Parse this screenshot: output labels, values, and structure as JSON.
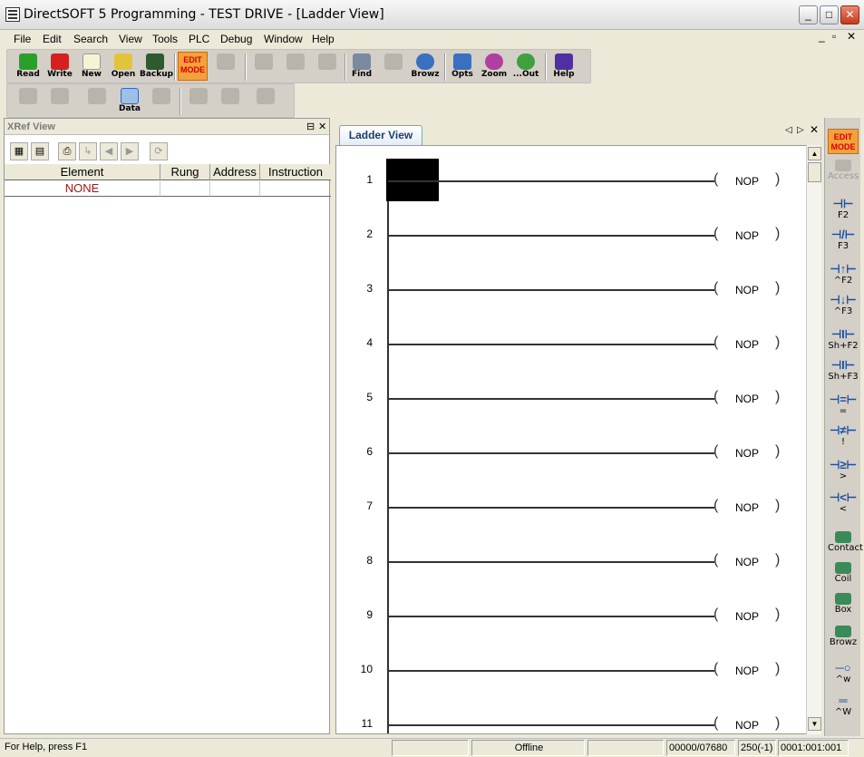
{
  "window": {
    "title": "DirectSOFT 5 Programming - TEST DRIVE - [Ladder View]",
    "minimize": "_",
    "maximize": "□",
    "close": "✕"
  },
  "menu": [
    "File",
    "Edit",
    "Search",
    "View",
    "Tools",
    "PLC",
    "Debug",
    "Window",
    "Help"
  ],
  "mdi_controls": {
    "minimize": "_",
    "restore": "▫",
    "close": "✕"
  },
  "toolbar1": [
    {
      "label": "Read",
      "icon": "read-icon",
      "color": "#2aa02a"
    },
    {
      "label": "Write",
      "icon": "write-icon",
      "color": "#d42020"
    },
    {
      "label": "New",
      "icon": "new-icon",
      "color": "#f5f5d6"
    },
    {
      "label": "Open",
      "icon": "open-icon",
      "color": "#e2c43a"
    },
    {
      "label": "Backup",
      "icon": "backup-icon",
      "color": "#2f5a2f"
    },
    {
      "label": "Find",
      "icon": "find-icon",
      "color": "#7a8aa0"
    },
    {
      "label": "Browz",
      "icon": "browse-icon",
      "color": "#3a70c0"
    },
    {
      "label": "Opts",
      "icon": "options-icon",
      "color": "#3a70c0"
    },
    {
      "label": "Zoom",
      "icon": "zoom-icon",
      "color": "#b040a0"
    },
    {
      "label": "...Out",
      "icon": "zoom-out-icon",
      "color": "#40a040"
    },
    {
      "label": "Help",
      "icon": "help-icon",
      "color": "#5030a0"
    }
  ],
  "toolbar2": {
    "data_label": "Data"
  },
  "edit_mode": {
    "line1": "EDIT",
    "line2": "MODE"
  },
  "xref": {
    "title": "XRef View",
    "pin": "⊟",
    "close": "✕",
    "columns": [
      "Element",
      "Rung",
      "Address",
      "Instruction"
    ],
    "rows": [
      {
        "element": "NONE",
        "rung": "",
        "address": "",
        "instruction": ""
      }
    ]
  },
  "ladder": {
    "tab_label": "Ladder View",
    "nav_prev": "◁",
    "nav_next": "▷",
    "nav_close": "✕",
    "rungs": [
      {
        "num": "1",
        "coil": "NOP"
      },
      {
        "num": "2",
        "coil": "NOP"
      },
      {
        "num": "3",
        "coil": "NOP"
      },
      {
        "num": "4",
        "coil": "NOP"
      },
      {
        "num": "5",
        "coil": "NOP"
      },
      {
        "num": "6",
        "coil": "NOP"
      },
      {
        "num": "7",
        "coil": "NOP"
      },
      {
        "num": "8",
        "coil": "NOP"
      },
      {
        "num": "9",
        "coil": "NOP"
      },
      {
        "num": "10",
        "coil": "NOP"
      },
      {
        "num": "11",
        "coil": "NOP"
      }
    ]
  },
  "right_toolbar": [
    {
      "glyph": "",
      "key": "Access",
      "icon": "access-icon"
    },
    {
      "glyph": "⊣⊢",
      "key": "F2",
      "icon": "normally-open-contact-icon"
    },
    {
      "glyph": "⊣/⊢",
      "key": "F3",
      "icon": "normally-closed-contact-icon"
    },
    {
      "glyph": "⊣↑⊢",
      "key": "^F2",
      "icon": "rising-edge-contact-icon"
    },
    {
      "glyph": "⊣↓⊢",
      "key": "^F3",
      "icon": "falling-edge-contact-icon"
    },
    {
      "glyph": "⊣I⊢",
      "key": "Sh+F2",
      "icon": "immediate-contact-icon"
    },
    {
      "glyph": "⊣I⊢",
      "key": "Sh+F3",
      "icon": "immediate-closed-contact-icon"
    },
    {
      "glyph": "⊣=⊢",
      "key": "=",
      "icon": "equal-compare-icon"
    },
    {
      "glyph": "⊣≠⊢",
      "key": "!",
      "icon": "not-equal-compare-icon"
    },
    {
      "glyph": "⊣≥⊢",
      "key": ">",
      "icon": "greater-compare-icon"
    },
    {
      "glyph": "⊣<⊢",
      "key": "<",
      "icon": "less-compare-icon"
    },
    {
      "glyph": "",
      "key": "Contact",
      "icon": "contact-icon"
    },
    {
      "glyph": "",
      "key": "Coil",
      "icon": "coil-icon"
    },
    {
      "glyph": "",
      "key": "Box",
      "icon": "box-icon"
    },
    {
      "glyph": "",
      "key": "Browz",
      "icon": "browse-icon"
    },
    {
      "glyph": "─○",
      "key": "^w",
      "icon": "wire-icon"
    },
    {
      "glyph": "═",
      "key": "^W",
      "icon": "wire-double-icon"
    }
  ],
  "status": {
    "help": "For Help, press F1",
    "mode": "Offline",
    "memory": "00000/07680",
    "position": "250(-1)",
    "address": "0001:001:001"
  }
}
